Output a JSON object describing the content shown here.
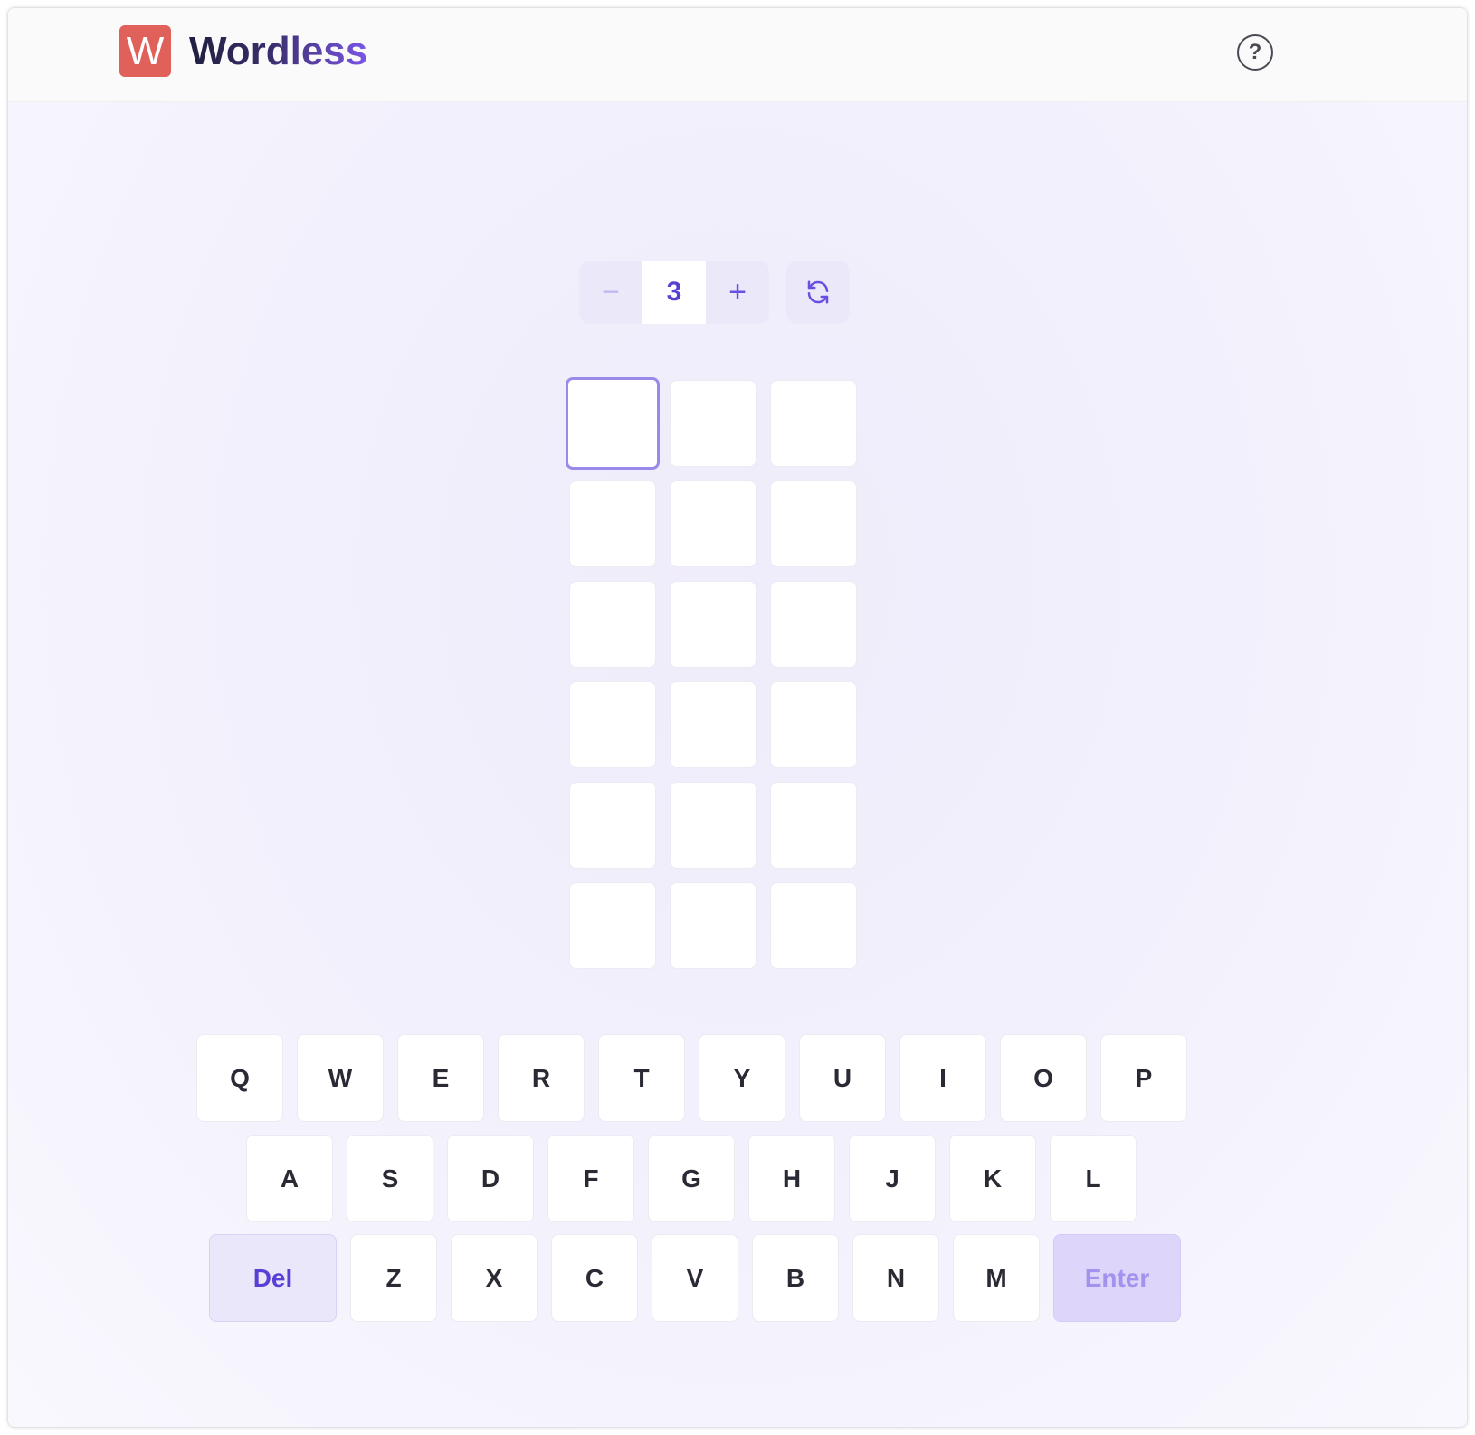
{
  "app": {
    "logo_letter": "W",
    "title": "Wordless",
    "help_label": "?"
  },
  "controls": {
    "decrement_label": "−",
    "word_length": "3",
    "increment_label": "+"
  },
  "board": {
    "rows": 6,
    "cols": 3,
    "active_cell": [
      0,
      0
    ]
  },
  "keyboard": {
    "row1": [
      "Q",
      "W",
      "E",
      "R",
      "T",
      "Y",
      "U",
      "I",
      "O",
      "P"
    ],
    "row2": [
      "A",
      "S",
      "D",
      "F",
      "G",
      "H",
      "J",
      "K",
      "L"
    ],
    "row3": [
      "Z",
      "X",
      "C",
      "V",
      "B",
      "N",
      "M"
    ],
    "del_label": "Del",
    "enter_label": "Enter"
  },
  "colors": {
    "accent": "#5a3fd6",
    "logo_bg": "#e0605a",
    "active_tile_border": "#9a88ea"
  }
}
